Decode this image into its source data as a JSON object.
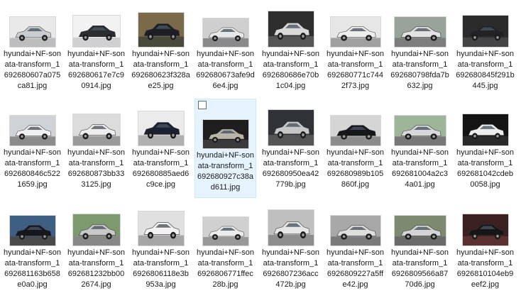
{
  "files": [
    {
      "name": "hyundai+NF-sonata-transform_1692680607a075ca81.jpg",
      "bg": "#e9e9e9",
      "car": "#c9ccd0",
      "ground": "#bdbdbd",
      "selected": false
    },
    {
      "name": "hyundai+NF-sonata-transform_1692680617e7c90914.jpg",
      "bg": "#f2f2f2",
      "car": "#2b2d31",
      "ground": "#d0d0d0",
      "selected": false
    },
    {
      "name": "hyundai+NF-sonata-transform_1692680623f328ae25.jpg",
      "bg": "#7a6a4a",
      "car": "#1d1f24",
      "ground": "#4a4a3a",
      "selected": false
    },
    {
      "name": "hyundai+NF-sonata-transform_1692680673afe9d6e4.jpg",
      "bg": "#cfcfcf",
      "car": "#e8e8ea",
      "ground": "#8a8a8a",
      "selected": false
    },
    {
      "name": "hyundai+NF-sonata-transform_1692680686e70b1c04.jpg",
      "bg": "#2e2e2e",
      "car": "#d9d9d9",
      "ground": "#555555",
      "selected": false
    },
    {
      "name": "hyundai+NF-sonata-transform_1692680771c7442f73.jpg",
      "bg": "#e6e6e6",
      "car": "#eeeeee",
      "ground": "#a0a0a0",
      "selected": false
    },
    {
      "name": "hyundai+NF-sonata-transform_1692680798fda7b632.jpg",
      "bg": "#9aa39a",
      "car": "#e2e2e2",
      "ground": "#7d7d7d",
      "selected": false
    },
    {
      "name": "hyundai+NF-sonata-transform_1692680845f291b445.jpg",
      "bg": "#2b2b2b",
      "car": "#202226",
      "ground": "#444444",
      "selected": false
    },
    {
      "name": "hyundai+NF-sonata-transform_1692680846c5221659.jpg",
      "bg": "#cfd2d6",
      "car": "#f0f0f0",
      "ground": "#8c8c8c",
      "selected": false
    },
    {
      "name": "hyundai+NF-sonata-transform_1692680873bb333125.jpg",
      "bg": "#dcdcdc",
      "car": "#eeeeee",
      "ground": "#9a9a9a",
      "selected": false
    },
    {
      "name": "hyundai+NF-sonata-transform_1692680885aed6c9ce.jpg",
      "bg": "#ebebeb",
      "car": "#1c2030",
      "ground": "#b0b0b0",
      "selected": false
    },
    {
      "name": "hyundai+NF-sonata-transform_1692680927c38ad611.jpg",
      "bg": "#1e1e1e",
      "car": "#b9b4a8",
      "ground": "#3a3a3a",
      "selected": true
    },
    {
      "name": "hyundai+NF-sonata-transform_1692680950ea42779b.jpg",
      "bg": "#2f3338",
      "car": "#c7c7c7",
      "ground": "#555555",
      "selected": false
    },
    {
      "name": "hyundai+NF-sonata-transform_1692680989b105860f.jpg",
      "bg": "#d5d5d5",
      "car": "#15171a",
      "ground": "#8c8c8c",
      "selected": false
    },
    {
      "name": "hyundai+NF-sonata-transform_1692681004a2c34a01.jpg",
      "bg": "#9fb59a",
      "car": "#d6d8db",
      "ground": "#777777",
      "selected": false
    },
    {
      "name": "hyundai+NF-sonata-transform_1692681042cdeb0058.jpg",
      "bg": "#141414",
      "car": "#ededed",
      "ground": "#2a2a2a",
      "selected": false
    },
    {
      "name": "hyundai+NF-sonata-transform_1692681163b658e0a0.jpg",
      "bg": "#3e5f82",
      "car": "#15171c",
      "ground": "#4a4a4a",
      "selected": false
    },
    {
      "name": "hyundai+NF-sonata-transform_1692681232bb002674.jpg",
      "bg": "#7c9a6e",
      "car": "#c8c8c8",
      "ground": "#888888",
      "selected": false
    },
    {
      "name": "hyundai+NF-sonata-transform_16926806118e3b953a.jpg",
      "bg": "#e0e0e0",
      "car": "#f2f2f2",
      "ground": "#a6a6a6",
      "selected": false
    },
    {
      "name": "hyundai+NF-sonata-transform_16926806771ffec28b.jpg",
      "bg": "#d0d0d0",
      "car": "#ececec",
      "ground": "#999999",
      "selected": false
    },
    {
      "name": "hyundai+NF-sonata-transform_16926807236acc472b.jpg",
      "bg": "#bfbfbf",
      "car": "#e6e6e6",
      "ground": "#8e8e8e",
      "selected": false
    },
    {
      "name": "hyundai+NF-sonata-transform_16926809227a5ffe42.jpg",
      "bg": "#a8a8a8",
      "car": "#dedede",
      "ground": "#7a7a7a",
      "selected": false
    },
    {
      "name": "hyundai+NF-sonata-transform_16926809566a8770d6.jpg",
      "bg": "#7e8a70",
      "car": "#d2d4d6",
      "ground": "#6a6a6a",
      "selected": false
    },
    {
      "name": "hyundai+NF-sonata-transform_16926810104eb9eef2.jpg",
      "bg": "#3a2020",
      "car": "#161616",
      "ground": "#5a3030",
      "selected": false
    }
  ]
}
